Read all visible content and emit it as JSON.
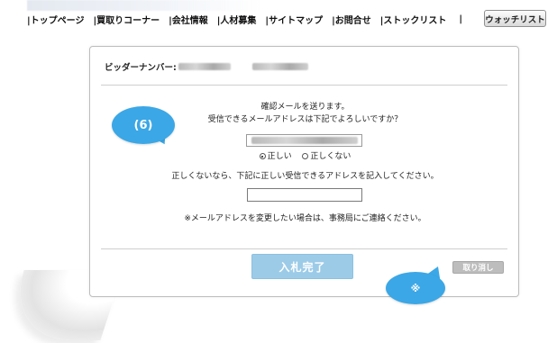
{
  "nav": {
    "items": [
      {
        "label": "|トップページ"
      },
      {
        "label": "|買取りコーナー"
      },
      {
        "label": "|会社情報"
      },
      {
        "label": "|人材募集"
      },
      {
        "label": "|サイトマップ"
      },
      {
        "label": "|お問合せ"
      },
      {
        "label": "|ストックリスト"
      }
    ],
    "trailing_separator": "|",
    "watchlist_label": "ウォッチリスト"
  },
  "dialog": {
    "bidder_label": "ビッダーナンバー:",
    "message_line1": "確認メールを送ります。",
    "message_line2": "受信できるメールアドレスは下記でよろしいですか？",
    "radio_yes_label": "正しい",
    "radio_no_label": "正しくない",
    "radio_selected": "正しい",
    "alt_instruction": "正しくないなら、下記に正しい受信できるアドレスを記入してください。",
    "alt_email_value": "",
    "note": "※メールアドレスを変更したい場合は、事務局にご連絡ください。",
    "submit_label": "入札完了",
    "cancel_label": "取り消し"
  },
  "annotations": {
    "bubble_step": "(6)",
    "bubble_note": "※"
  },
  "colors": {
    "bubble": "#3ba7e6",
    "submit_button": "#9ccbe8",
    "cancel_button": "#bdbdbd"
  }
}
